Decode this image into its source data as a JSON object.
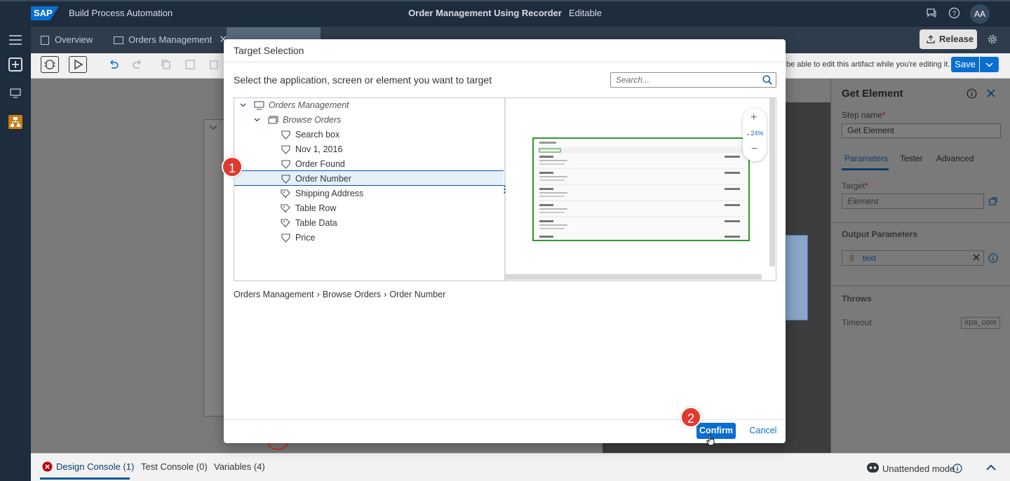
{
  "shell": {
    "logo": "SAP",
    "product": "Build Process Automation",
    "title": "Order Management Using Recorder",
    "status": "Editable",
    "avatar": "AA"
  },
  "tabs": [
    {
      "label": "Overview"
    },
    {
      "label": "Orders Management"
    }
  ],
  "toolbar": {
    "release_label": "Release",
    "info_text": "be able to edit this artifact while you're editing it.",
    "save_label": "Save"
  },
  "right_panel": {
    "title": "Get Element",
    "step_name_label": "Step name",
    "step_name_value": "Get Element",
    "tabs": [
      "Parameters",
      "Tester",
      "Advanced"
    ],
    "target_label": "Target",
    "target_placeholder": "Element",
    "output_label": "Output Parameters",
    "output_type": "8",
    "output_value": "text",
    "throws_label": "Throws",
    "timeout_label": "Timeout",
    "timeout_value": "irpa_core"
  },
  "bottom": {
    "tabs": [
      "Design Console (1)",
      "Test Console (0)",
      "Variables (4)"
    ],
    "mode": "Unattended mode"
  },
  "modal": {
    "title": "Target Selection",
    "prompt": "Select the application, screen or element you want to target",
    "search_placeholder": "Search...",
    "tree": [
      {
        "label": "Orders Management",
        "level": 0,
        "italic": true,
        "icon": "screen-icon"
      },
      {
        "label": "Browse Orders",
        "level": 1,
        "italic": true,
        "icon": "screens-icon"
      },
      {
        "label": "Search box",
        "level": 2,
        "icon": "element-icon"
      },
      {
        "label": "Nov 1, 2016",
        "level": 2,
        "icon": "element-icon"
      },
      {
        "label": "Order Found",
        "level": 2,
        "icon": "element-icon"
      },
      {
        "label": "Order Number",
        "level": 2,
        "icon": "element-icon",
        "selected": true
      },
      {
        "label": "Shipping Address",
        "level": 2,
        "icon": "collection-icon"
      },
      {
        "label": "Table Row",
        "level": 2,
        "icon": "collection-icon"
      },
      {
        "label": "Table Data",
        "level": 2,
        "icon": "collection-icon"
      },
      {
        "label": "Price",
        "level": 2,
        "icon": "element-icon"
      }
    ],
    "zoom": "24%",
    "breadcrumb": [
      "Orders Management",
      "Browse Orders",
      "Order Number"
    ],
    "confirm_label": "Confirm",
    "cancel_label": "Cancel"
  },
  "steps": [
    "1",
    "2"
  ],
  "colors": {
    "shell": "#1d2d3e",
    "accent": "#0a6ed1",
    "step_marker": "#e03a2f",
    "preview_highlight": "#2e9a2e"
  }
}
